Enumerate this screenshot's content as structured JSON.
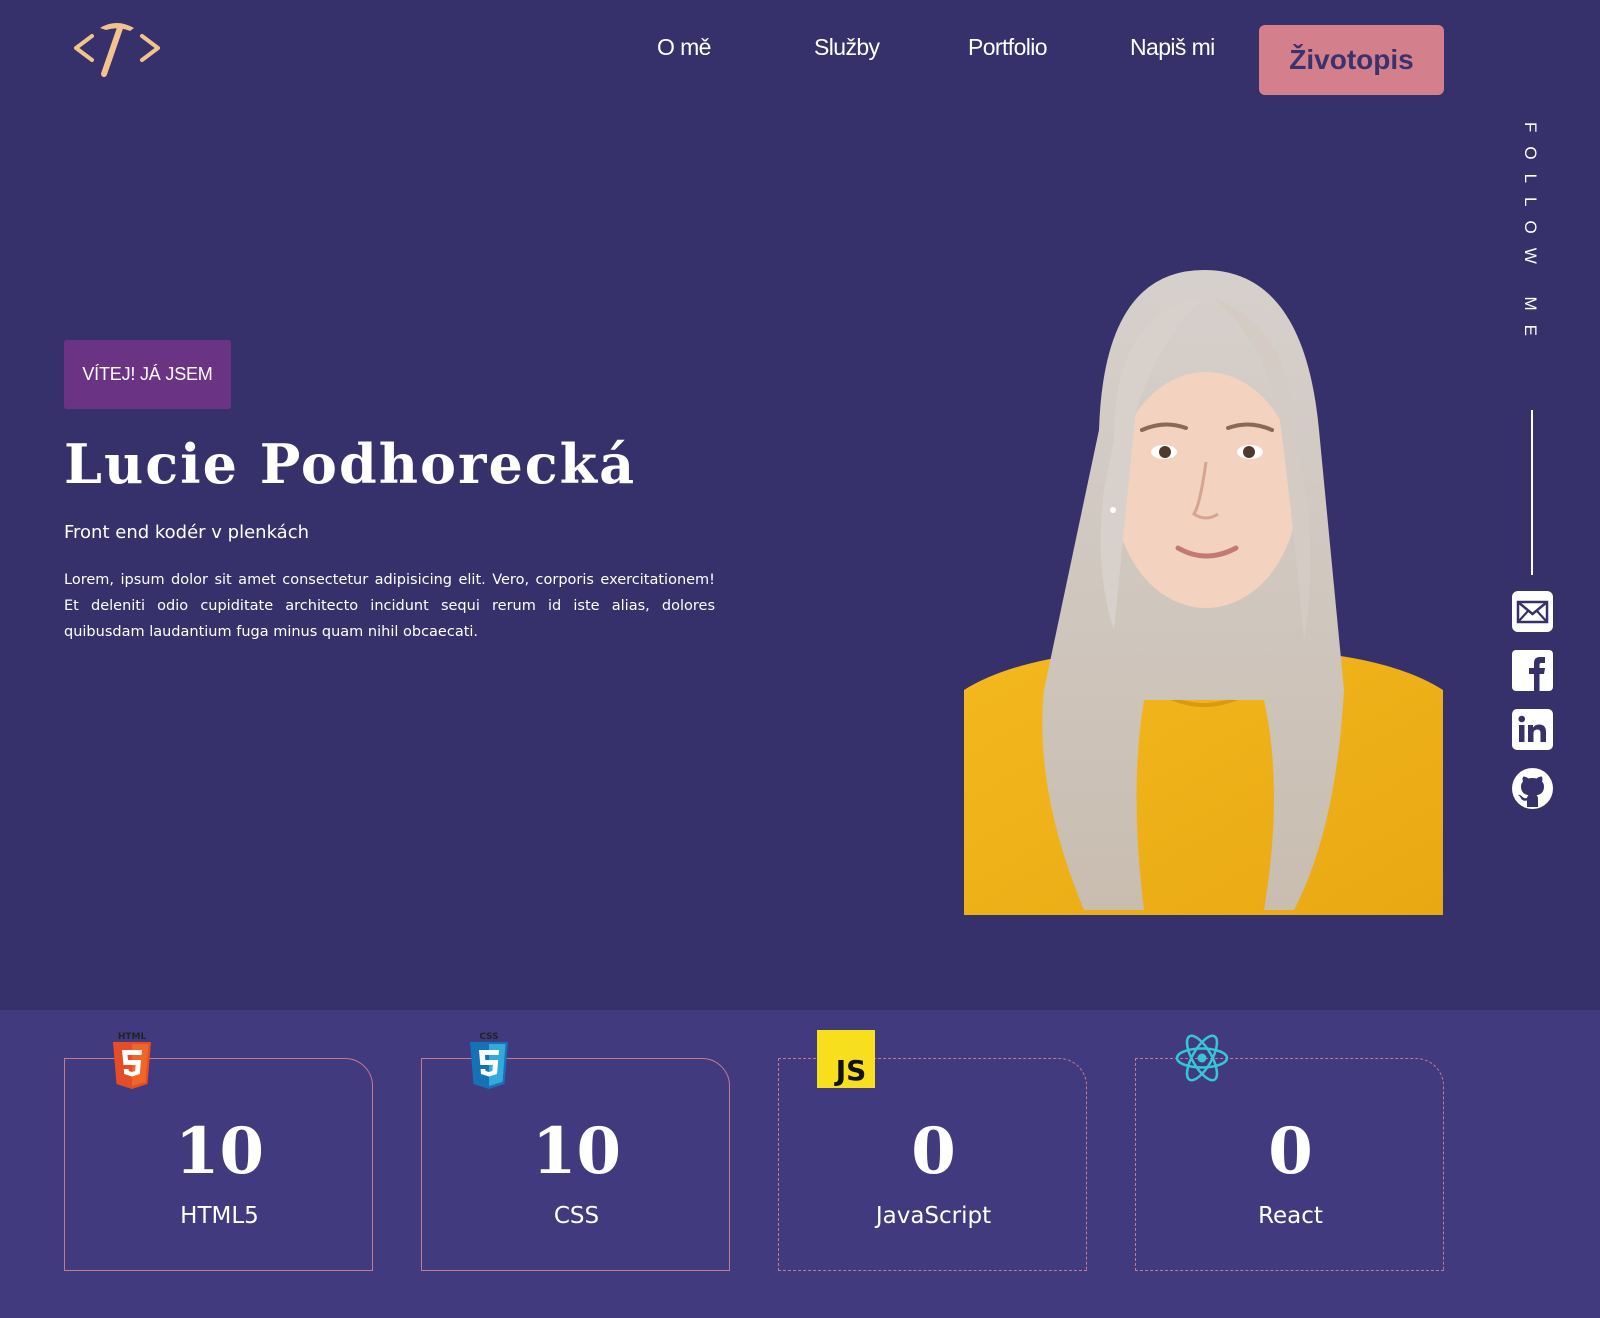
{
  "nav": {
    "items": [
      {
        "label": "O mě"
      },
      {
        "label": "Služby"
      },
      {
        "label": "Portfolio"
      },
      {
        "label": "Napiš mi"
      }
    ],
    "cta_label": "Životopis"
  },
  "hero": {
    "badge": "VÍTEJ! JÁ JSEM",
    "name": "Lucie Podhorecká",
    "subtitle": "Front end kodér v plenkách",
    "text": "Lorem, ipsum dolor sit amet consectetur adipisicing elit. Vero, corporis exercitationem! Et deleniti odio cupiditate architecto incidunt sequi rerum id iste alias, dolores quibusdam laudantium fuga minus quam nihil obcaecati."
  },
  "follow": {
    "label": "FOLLOW ME",
    "icons": [
      "email-icon",
      "facebook-icon",
      "linkedin-icon",
      "github-icon"
    ]
  },
  "skills": [
    {
      "name": "HTML5",
      "count": "10",
      "icon": "html5-icon",
      "icon_label": "HTML"
    },
    {
      "name": "CSS",
      "count": "10",
      "icon": "css3-icon",
      "icon_label": "CSS"
    },
    {
      "name": "JavaScript",
      "count": "0",
      "icon": "javascript-icon",
      "icon_label": "JS"
    },
    {
      "name": "React",
      "count": "0",
      "icon": "react-icon"
    }
  ],
  "colors": {
    "background": "#37316b",
    "skills_band": "#423a7f",
    "accent": "#d47f8c",
    "badge": "#6b3384",
    "logo": "#f4c28e",
    "shirt": "#f2b51b"
  }
}
